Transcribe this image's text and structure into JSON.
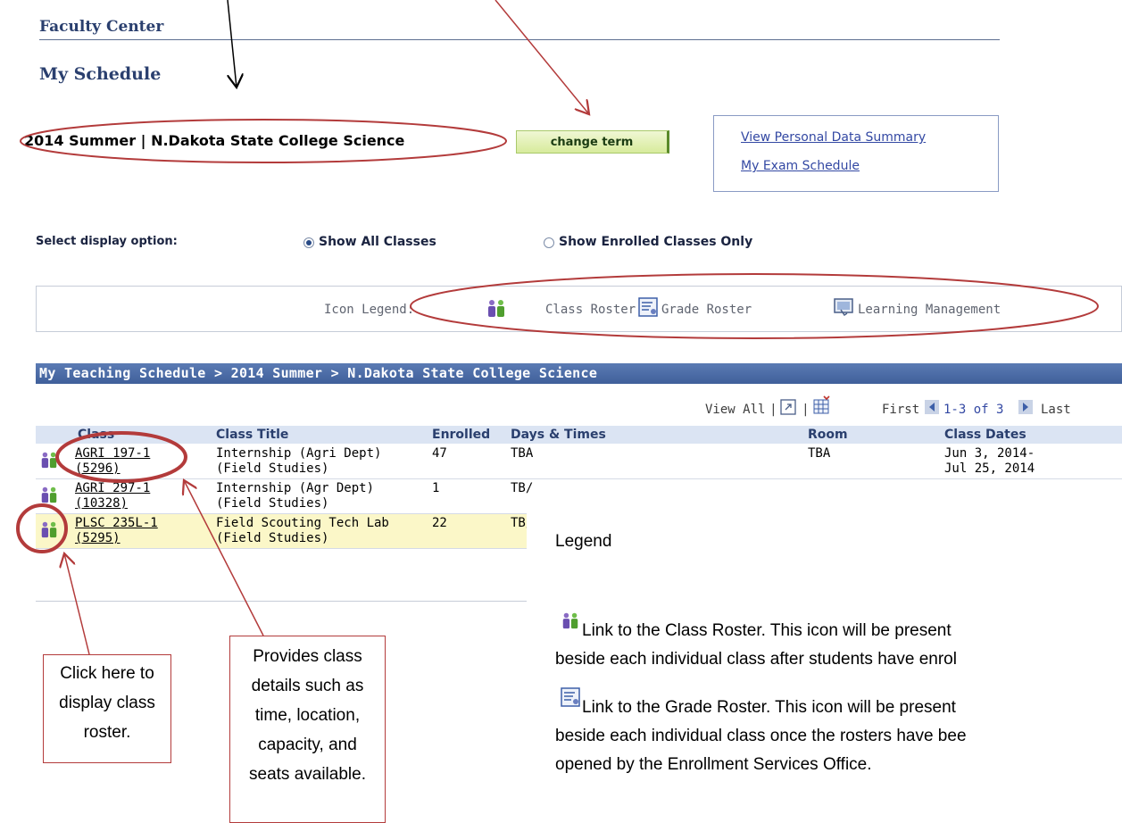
{
  "header": {
    "faculty_center": "Faculty Center",
    "my_schedule": "My Schedule"
  },
  "term": {
    "label": "2014 Summer | N.Dakota State College Science",
    "change_button": "change term"
  },
  "links": {
    "personal_data": "View Personal Data Summary",
    "exam_schedule": "My Exam Schedule"
  },
  "display_option": {
    "label": "Select display option:",
    "options": [
      "Show All Classes",
      "Show Enrolled Classes Only"
    ],
    "selected": "Show All Classes"
  },
  "icon_legend": {
    "label": "Icon Legend:",
    "items": [
      "Class Roster",
      "Grade Roster",
      "Learning Management"
    ]
  },
  "teaching_schedule": {
    "title": "My Teaching Schedule > 2014 Summer > N.Dakota State College Science",
    "view_all": "View All",
    "sep": "|",
    "first": "First",
    "range": "1-3 of 3",
    "last": "Last",
    "columns": [
      "Class",
      "Class Title",
      "Enrolled",
      "Days & Times",
      "Room",
      "Class Dates"
    ],
    "rows": [
      {
        "class_l1": "AGRI 197-1",
        "class_l2": "(5296)",
        "title_l1": "Internship (Agri Dept)",
        "title_l2": "(Field Studies)",
        "enrolled": "47",
        "days": "TBA",
        "room": "TBA",
        "dates_l1": "Jun 3, 2014-",
        "dates_l2": "Jul 25, 2014"
      },
      {
        "class_l1": "AGRI 297-1",
        "class_l2": "(10328)",
        "title_l1": "Internship (Agr Dept)",
        "title_l2": "(Field Studies)",
        "enrolled": "1",
        "days": "TB/",
        "room": "",
        "dates_l1": "",
        "dates_l2": ""
      },
      {
        "class_l1": "PLSC 235L-1",
        "class_l2": "(5295)",
        "title_l1": "Field Scouting Tech Lab",
        "title_l2": "(Field Studies)",
        "enrolled": "22",
        "days": "TB/",
        "room": "",
        "dates_l1": "",
        "dates_l2": ""
      }
    ]
  },
  "callouts": {
    "roster": [
      "Click here to",
      "display class",
      "roster."
    ],
    "details": [
      "Provides class",
      "details such as",
      "time, location,",
      "capacity, and",
      "seats available."
    ]
  },
  "legend": {
    "title": "Legend",
    "class_roster_l1": "Link to the Class Roster. This icon will be present",
    "class_roster_l2": "beside each individual class after students have enrol",
    "grade_roster_l1": "Link to the Grade Roster. This icon will be present",
    "grade_roster_l2": "beside each individual class once the rosters have bee",
    "grade_roster_l3": "opened by the Enrollment Services Office."
  },
  "colors": {
    "annotation": "#b33b3b",
    "heading": "#2a3f6e",
    "link": "#3348a3",
    "header_bar": "#4a6aa6",
    "highlight_row": "#fbf7c8"
  }
}
